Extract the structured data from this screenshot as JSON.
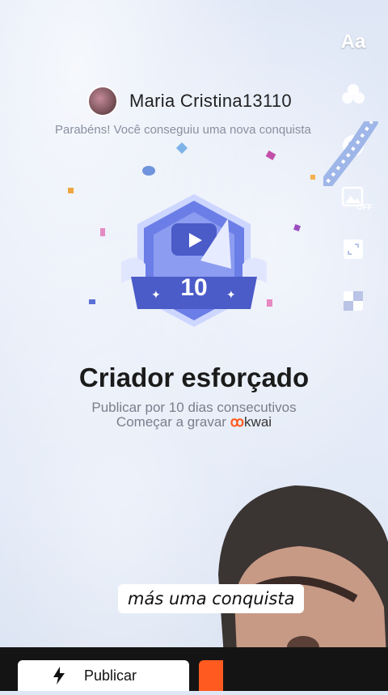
{
  "header": {
    "username": "Maria Cristina13110"
  },
  "congrats_text": "Parabéns! Você conseguiu uma nova conquista",
  "badge": {
    "level": "10",
    "colors": {
      "primary": "#6b7de6",
      "dark": "#4b5bc8",
      "light": "#cdd6ff"
    }
  },
  "achievement": {
    "title": "Criador esforçado",
    "description": "Publicar por 10 dias consecutivos",
    "record_label": "Começar a gravar",
    "brand": "kwai"
  },
  "right_rail": [
    {
      "name": "text-tool-icon",
      "label": "Aa"
    },
    {
      "name": "filters-icon"
    },
    {
      "name": "sticker-icon"
    },
    {
      "name": "image-off-icon",
      "badge": "OFF"
    },
    {
      "name": "crop-icon"
    },
    {
      "name": "layout-icon"
    }
  ],
  "caption": "más uma conquista",
  "bottom": {
    "publish_label": "Publicar"
  },
  "colors": {
    "brand_orange": "#ff5a1f",
    "bottom_bar": "#141414"
  }
}
